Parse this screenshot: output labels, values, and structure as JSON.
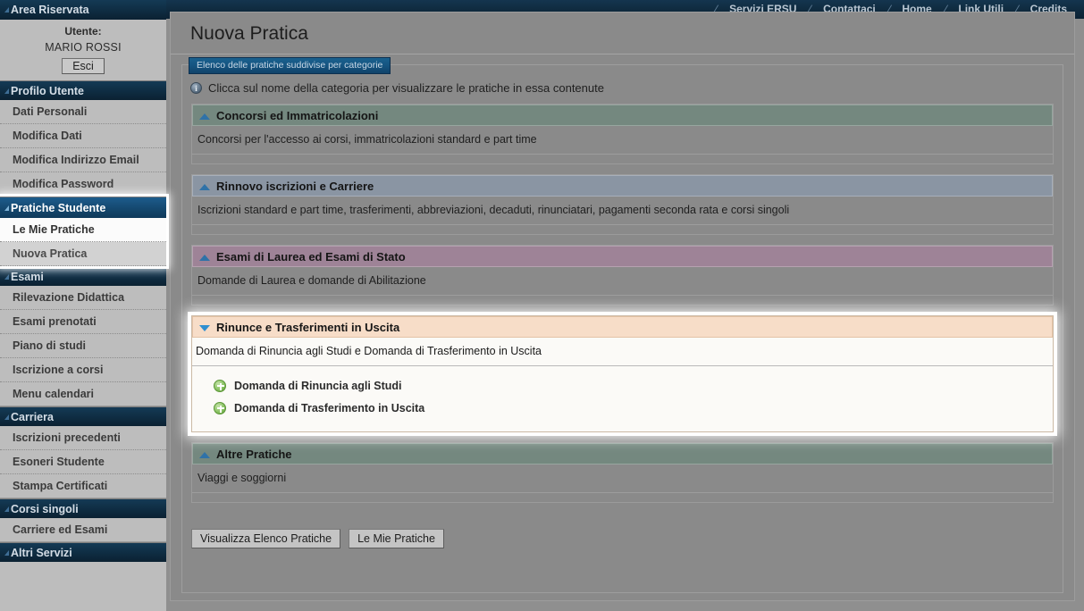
{
  "topnav": {
    "items": [
      {
        "label": "Servizi ERSU"
      },
      {
        "label": "Contattaci"
      },
      {
        "label": "Home"
      },
      {
        "label": "Link Utili"
      },
      {
        "label": "Credits"
      }
    ],
    "separator": "/"
  },
  "sidebar": {
    "title": "Area Riservata",
    "user_label": "Utente:",
    "user_name": "MARIO ROSSI",
    "logout_label": "Esci",
    "groups": [
      {
        "title": "Profilo Utente",
        "selected": false,
        "items": [
          {
            "label": "Dati Personali",
            "state": "normal"
          },
          {
            "label": "Modifica Dati",
            "state": "normal"
          },
          {
            "label": "Modifica Indirizzo Email",
            "state": "normal"
          },
          {
            "label": "Modifica Password",
            "state": "normal"
          }
        ]
      },
      {
        "title": "Pratiche Studente",
        "selected": true,
        "items": [
          {
            "label": "Le Mie Pratiche",
            "state": "light"
          },
          {
            "label": "Nuova Pratica",
            "state": "active"
          }
        ]
      },
      {
        "title": "Esami",
        "selected": false,
        "items": [
          {
            "label": "Rilevazione Didattica",
            "state": "normal"
          },
          {
            "label": "Esami prenotati",
            "state": "normal"
          },
          {
            "label": "Piano di studi",
            "state": "normal"
          },
          {
            "label": "Iscrizione a corsi",
            "state": "normal"
          },
          {
            "label": "Menu calendari",
            "state": "normal"
          }
        ]
      },
      {
        "title": "Carriera",
        "selected": false,
        "items": [
          {
            "label": "Iscrizioni precedenti",
            "state": "normal"
          },
          {
            "label": "Esoneri Studente",
            "state": "normal"
          },
          {
            "label": "Stampa Certificati",
            "state": "normal"
          }
        ]
      },
      {
        "title": "Corsi singoli",
        "selected": false,
        "items": [
          {
            "label": "Carriere ed Esami",
            "state": "normal"
          }
        ]
      },
      {
        "title": "Altri Servizi",
        "selected": false,
        "items": []
      }
    ]
  },
  "main": {
    "page_title": "Nuova Pratica",
    "legend_tab": "Elenco delle pratiche suddivise per categorie",
    "hint_text": "Clicca sul nome della categoria per visualizzare le pratiche in essa contenute",
    "info_glyph": "i",
    "categories": [
      {
        "title": "Concorsi ed Immatricolazioni",
        "description": "Concorsi per l'accesso ai corsi, immatricolazioni standard e part time",
        "color": "green",
        "expanded": false,
        "header_color": "#74887f",
        "links": []
      },
      {
        "title": "Rinnovo iscrizioni e Carriere",
        "description": "Iscrizioni standard e part time, trasferimenti, abbreviazioni, decaduti, rinunciatari, pagamenti seconda rata e corsi singoli",
        "color": "blue",
        "expanded": false,
        "header_color": "#8a95a3",
        "links": []
      },
      {
        "title": "Esami di Laurea ed Esami di Stato",
        "description": "Domande di Laurea e domande di Abilitazione",
        "color": "purple",
        "expanded": false,
        "header_color": "#9e8397",
        "links": []
      },
      {
        "title": "Rinunce e Trasferimenti in Uscita",
        "description": "Domanda di Rinuncia agli Studi e Domanda di Trasferimento in Uscita",
        "color": "open",
        "expanded": true,
        "header_color": "#f7ddc8",
        "links": [
          {
            "label": "Domanda di Rinuncia agli Studi"
          },
          {
            "label": "Domanda di Trasferimento in Uscita"
          }
        ]
      },
      {
        "title": "Altre Pratiche",
        "description": "Viaggi e soggiorni",
        "color": "green",
        "expanded": false,
        "header_color": "#74887f",
        "links": []
      }
    ],
    "buttons": [
      {
        "label": "Visualizza Elenco Pratiche"
      },
      {
        "label": "Le Mie Pratiche"
      }
    ]
  },
  "colors": {
    "topbar": "#0f2a3e",
    "sidebar_head": "#10304a",
    "sidebar_selected": "#175party",
    "accent_blue": "#2f72a8",
    "page_bg": "#8a8a8a",
    "highlight_header": "#f7ddc8",
    "plus_green": "#6fae45"
  }
}
